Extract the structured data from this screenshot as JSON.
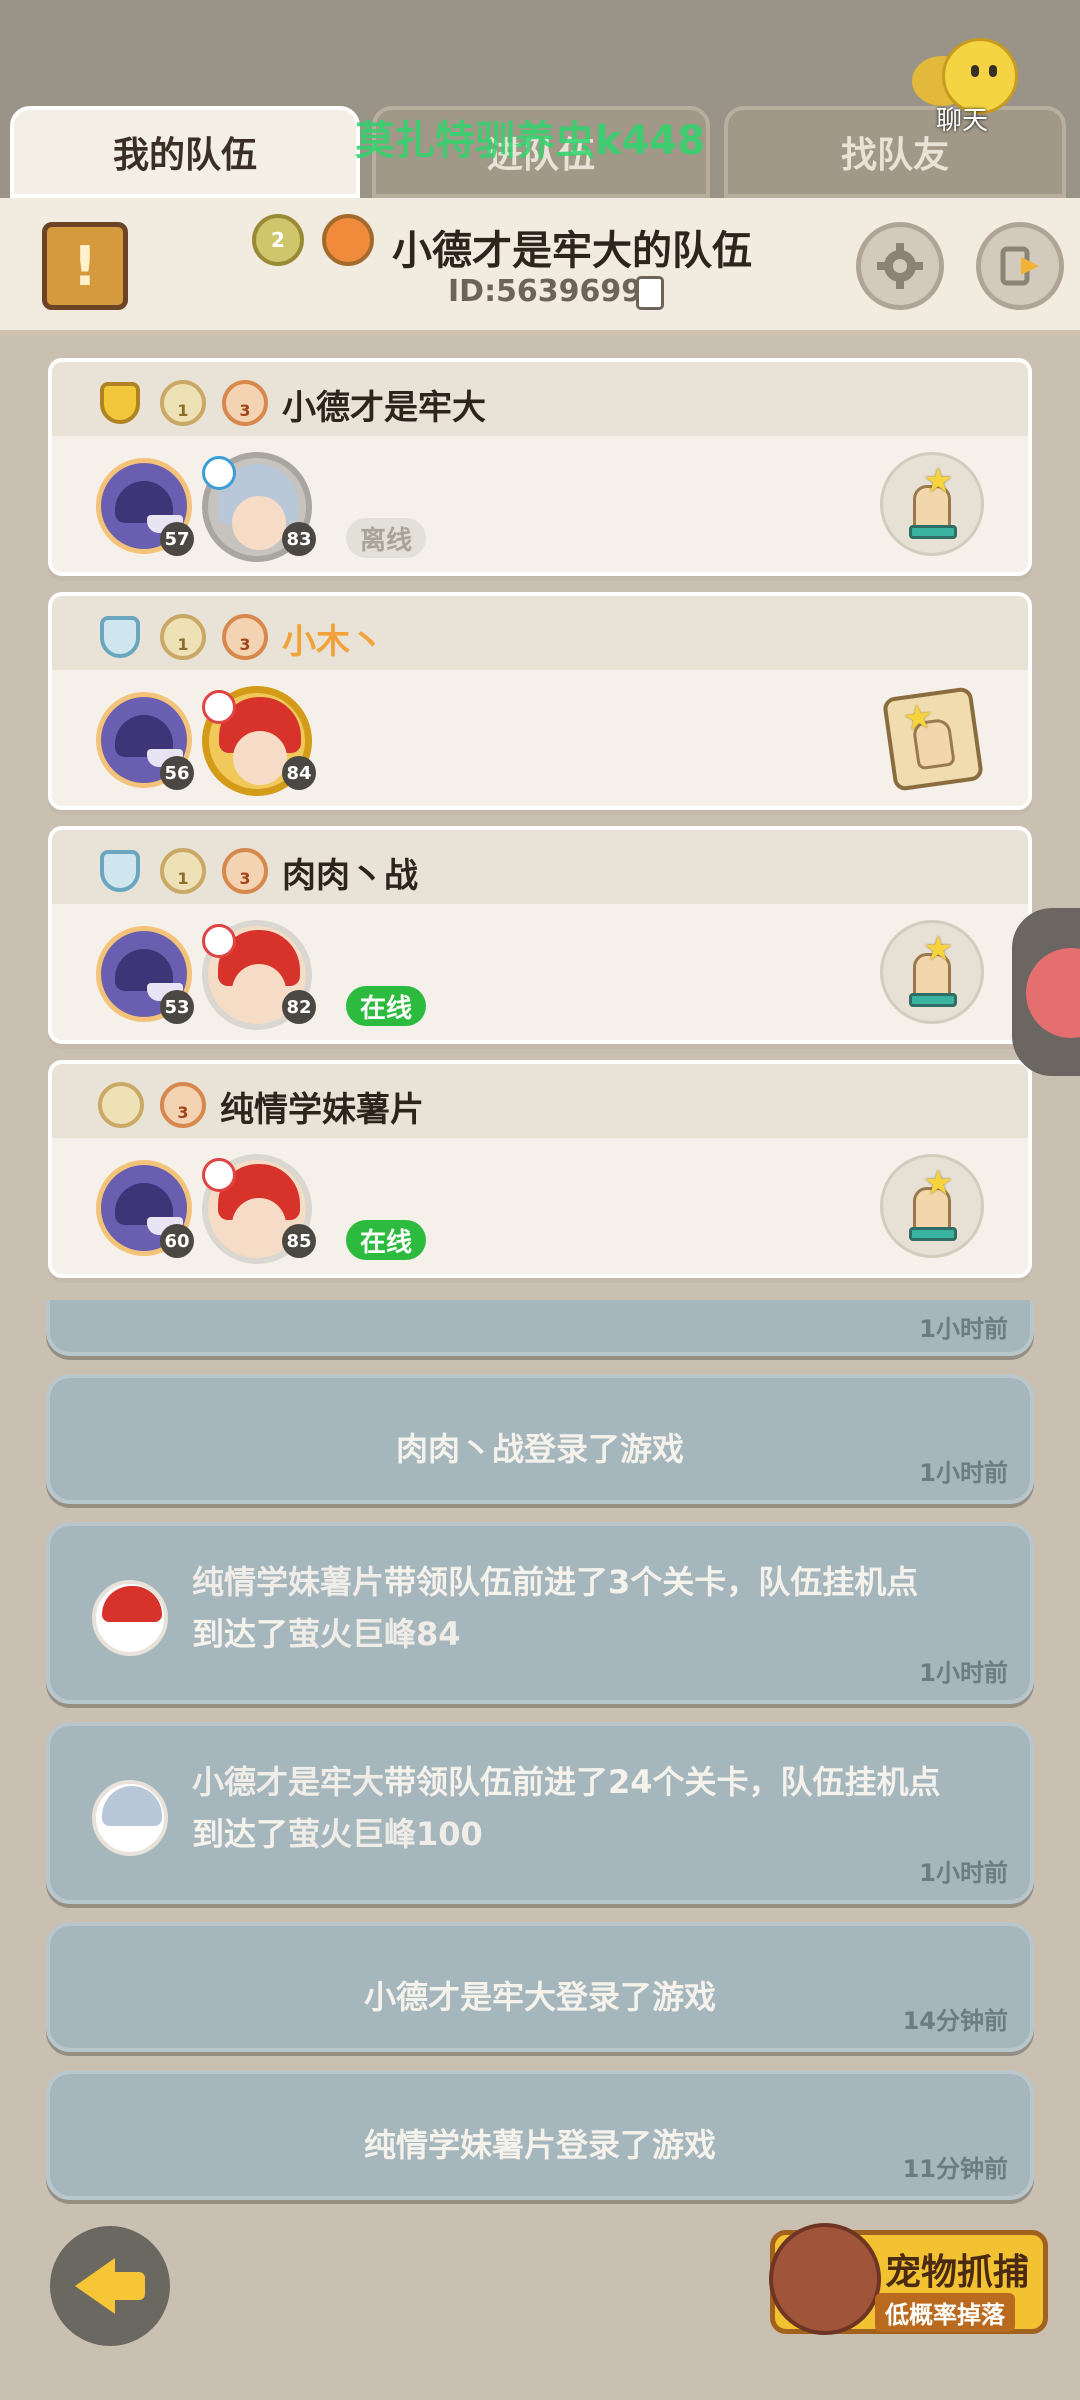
{
  "tabs": [
    {
      "label": "我的队伍",
      "active": true
    },
    {
      "label": "进队伍",
      "active": false
    },
    {
      "label": "找队友",
      "active": false
    }
  ],
  "watermark": "莫扎特驯养虫k448",
  "chat_label": "聊天",
  "team": {
    "name": "小德才是牢大的队伍",
    "id_text": "ID:5639699",
    "badge_level_1": "2"
  },
  "members": [
    {
      "name": "小德才是牢大",
      "name_color": "default",
      "shield": "gold",
      "badge_a": "1",
      "badge_b": "3",
      "pet_level": "57",
      "avatar_level": "83",
      "status": "离线"
    },
    {
      "name": "小木丶",
      "name_color": "orange",
      "shield": "blue",
      "badge_a": "1",
      "badge_b": "3",
      "pet_level": "56",
      "avatar_level": "84",
      "status": ""
    },
    {
      "name": "肉肉丶战",
      "name_color": "default",
      "shield": "blue",
      "badge_a": "1",
      "badge_b": "3",
      "pet_level": "53",
      "avatar_level": "82",
      "status": "在线"
    },
    {
      "name": "纯情学妹薯片",
      "name_color": "default",
      "shield": "",
      "badge_a": "",
      "badge_b": "3",
      "pet_level": "60",
      "avatar_level": "85",
      "status": "在线"
    }
  ],
  "feed": [
    {
      "time": "1小时前"
    },
    {
      "name": "肉肉丶战",
      "text": "登录了游戏",
      "time": "1小时前"
    },
    {
      "name": "纯情学妹薯片",
      "text_1": "带领队伍前进了3个关卡，队伍挂机点",
      "text_2": "到达了",
      "place": "萤火巨峰84",
      "time": "1小时前"
    },
    {
      "name": "小德才是牢大",
      "text_1": "带领队伍前进了24个关卡，队伍挂机点",
      "text_2": "到达了",
      "place": "萤火巨峰100",
      "time": "1小时前"
    },
    {
      "name": "小德才是牢大",
      "text": "登录了游戏",
      "time": "14分钟前"
    },
    {
      "name": "纯情学妹薯片",
      "text": "登录了游戏",
      "time": "11分钟前"
    }
  ],
  "catch_button": {
    "title": "宠物抓捕",
    "subtitle": "低概率掉落"
  },
  "colors": {
    "online": "#2dbb3f",
    "accent": "#f3c232",
    "feed_bg": "#a5b6bd"
  }
}
